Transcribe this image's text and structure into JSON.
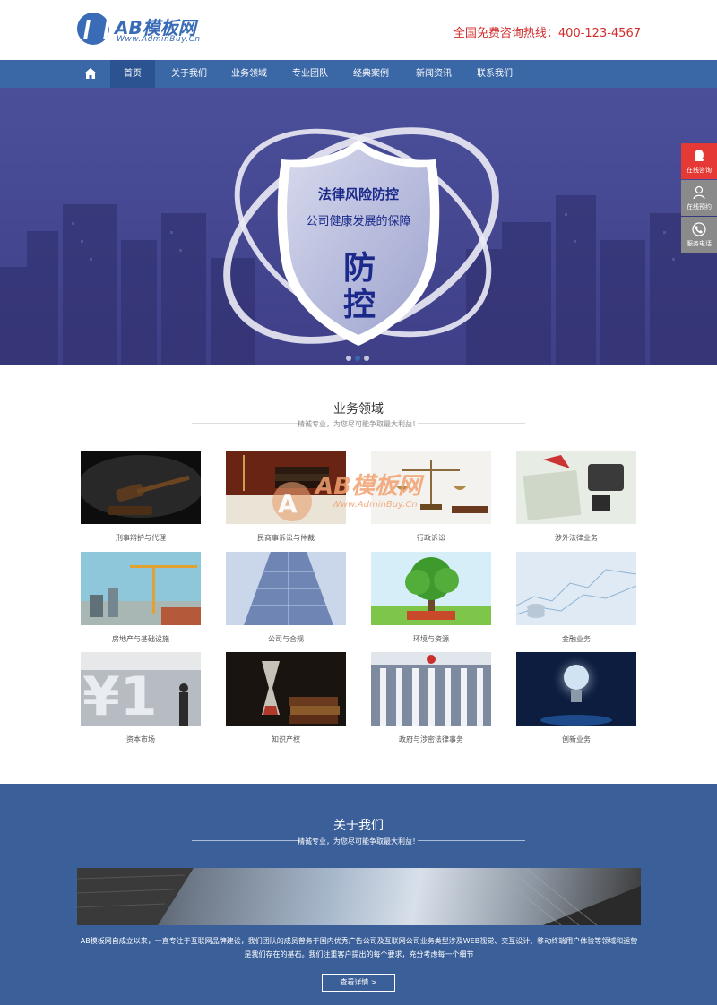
{
  "header": {
    "logo_text": "AB模板网",
    "logo_sub": "Www.AdminBuy.Cn",
    "hotline": "全国免费咨询热线：400-123-4567"
  },
  "nav": {
    "items": [
      "首页",
      "关于我们",
      "业务领域",
      "专业团队",
      "经典案例",
      "新闻资讯",
      "联系我们"
    ],
    "active_index": 0
  },
  "banner": {
    "title": "法律风险防控",
    "subtitle": "公司健康发展的保障",
    "big1": "防",
    "big2": "控",
    "slide_count": 3,
    "active_slide": 1
  },
  "float_panel": {
    "items": [
      {
        "label": "在线咨询",
        "icon": "qq-icon",
        "color": "#e53935"
      },
      {
        "label": "在线预约",
        "icon": "user-icon",
        "color": "#8a8a8a"
      },
      {
        "label": "服务电话",
        "icon": "phone-icon",
        "color": "#8a8a8a"
      }
    ]
  },
  "business": {
    "title": "业务领域",
    "subtitle": "精诚专业，为您尽可能争取最大利益！",
    "cards": [
      {
        "label": "刑事辩护与代理",
        "theme": "gavel"
      },
      {
        "label": "民商事诉讼与仲裁",
        "theme": "books"
      },
      {
        "label": "行政诉讼",
        "theme": "scales"
      },
      {
        "label": "涉外法律业务",
        "theme": "documents"
      },
      {
        "label": "房地产与基础设施",
        "theme": "crane"
      },
      {
        "label": "公司与合规",
        "theme": "building"
      },
      {
        "label": "环境与资源",
        "theme": "tree"
      },
      {
        "label": "金融业务",
        "theme": "finance"
      },
      {
        "label": "资本市场",
        "theme": "market"
      },
      {
        "label": "知识产权",
        "theme": "hourglass"
      },
      {
        "label": "政府与涉密法律事务",
        "theme": "government"
      },
      {
        "label": "创新业务",
        "theme": "bulb"
      }
    ]
  },
  "watermark": {
    "text": "AB模板网",
    "sub": "Www.AdminBuy.Cn"
  },
  "about": {
    "title": "关于我们",
    "subtitle": "精诚专业，为您尽可能争取最大利益！",
    "text": "AB模板网自成立以来，一直专注于互联网品牌建设，我们团队的成员曾务于国内优秀广告公司及互联网公司业务类型涉及WEB视觉、交互设计、移动终端用户体验等领域和运营是我们存在的基石。我们注重客户提出的每个要求，充分考虑每一个细节",
    "button": "查看详情 >"
  },
  "colors": {
    "primary": "#3a67a6",
    "nav_active": "#2b5391",
    "hotline": "#d12d2d",
    "about_bg": "#3a5f99"
  }
}
